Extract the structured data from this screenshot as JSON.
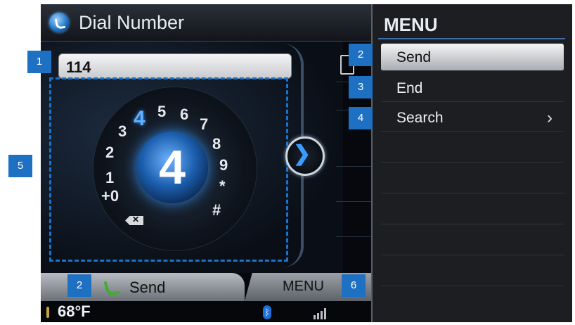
{
  "header": {
    "title": "Dial Number"
  },
  "dialer": {
    "number": "114",
    "center_digit": "4",
    "digits": [
      "4",
      "5",
      "6",
      "7",
      "8",
      "9",
      "*",
      "#",
      "3",
      "2",
      "1",
      "+0"
    ],
    "backspace_glyph": "✕"
  },
  "bottom_bar": {
    "send_label": "Send",
    "menu_label": "MENU"
  },
  "status": {
    "temperature": "68°F",
    "bluetooth_glyph": "ᛒ"
  },
  "menu": {
    "title": "MENU",
    "items": [
      {
        "label": "Send",
        "selected": true
      },
      {
        "label": "End",
        "selected": false
      },
      {
        "label": "Search",
        "selected": false,
        "has_submenu": true
      }
    ],
    "chevron": "›"
  },
  "nav_arrow_glyph": "❯",
  "callouts": {
    "c1": "1",
    "c2a": "2",
    "c3": "3",
    "c4": "4",
    "c5": "5",
    "c2b": "2",
    "c6": "6"
  },
  "colors": {
    "accent": "#1e70c3",
    "send_green": "#3fae2a"
  }
}
